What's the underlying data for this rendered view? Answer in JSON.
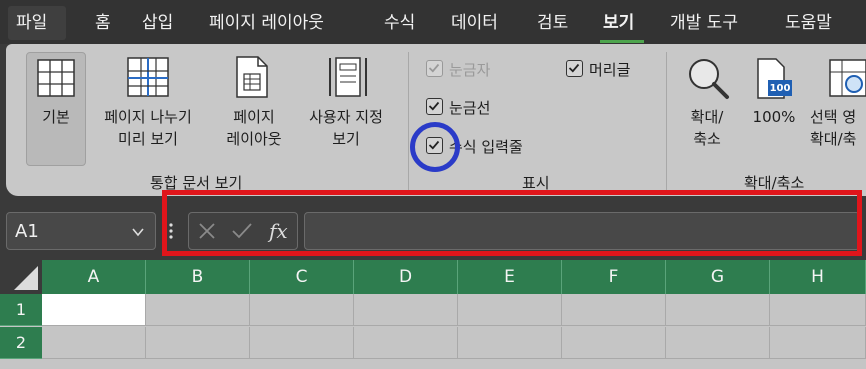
{
  "tabs": {
    "file": "파일",
    "home": "홈",
    "insert": "삽입",
    "page_layout": "페이지 레이아웃",
    "formulas": "수식",
    "data": "데이터",
    "review": "검토",
    "view": "보기",
    "developer": "개발 도구",
    "help": "도움말"
  },
  "ribbon": {
    "workbook_views": {
      "normal": "기본",
      "page_break": "페이지 나누기\n미리 보기",
      "page_layout": "페이지\n레이아웃",
      "custom_views": "사용자 지정\n보기",
      "group_label": "통합 문서 보기"
    },
    "show": {
      "ruler": "눈금자",
      "gridlines": "눈금선",
      "formula_bar": "수식 입력줄",
      "headings": "머리글",
      "group_label": "표시"
    },
    "zoom": {
      "zoom": "확대/\n축소",
      "hundred": "100%",
      "hundred_icon_text": "100",
      "zoom_to_selection": "선택 영\n확대/축",
      "group_label": "확대/축소"
    }
  },
  "formula_bar": {
    "name_box": "A1",
    "fx": "fx",
    "value": ""
  },
  "grid": {
    "columns": [
      "A",
      "B",
      "C",
      "D",
      "E",
      "F",
      "G",
      "H"
    ],
    "rows": [
      "1",
      "2"
    ]
  },
  "colors": {
    "header_green": "#2e7d4f",
    "highlight_red": "#e0151b",
    "highlight_blue": "#2a3bc8",
    "tab_underline": "#4ea54e"
  }
}
